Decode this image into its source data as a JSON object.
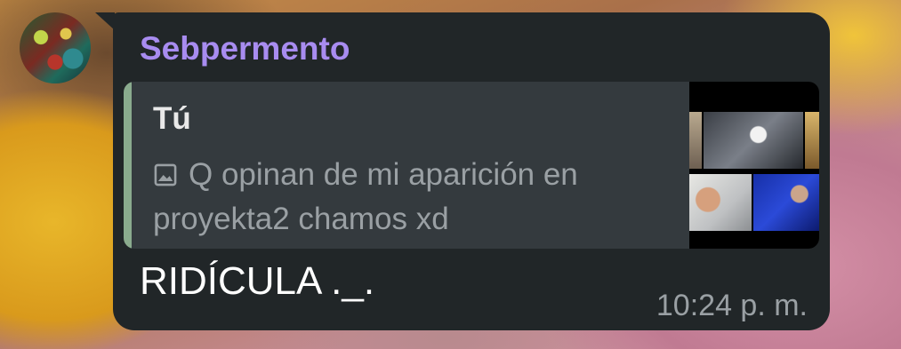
{
  "chat": {
    "sender_name": "Sebpermento",
    "reply": {
      "author": "Tú",
      "media_icon": "image-icon",
      "text": "Q opinan de mi aparición en proyekta2 chamos xd"
    },
    "message": "RIDÍCULA ._.",
    "time": "10:24 p. m."
  },
  "colors": {
    "bubble": "#212628",
    "sender": "#a88cf0",
    "reply_bar": "#8aab8e",
    "reply_bg": "#343a3e",
    "muted_text": "#9aa0a4"
  }
}
